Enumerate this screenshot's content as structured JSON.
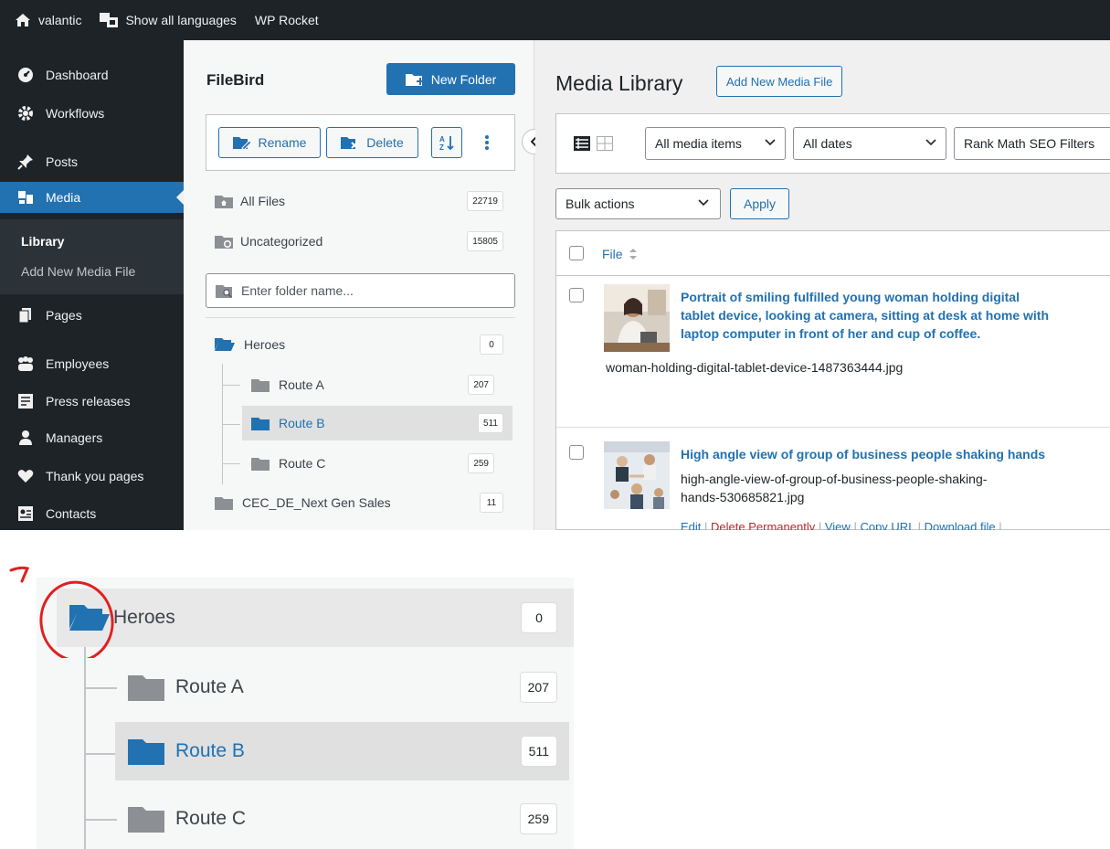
{
  "admin_bar": {
    "site_name": "valantic",
    "languages": "Show all languages",
    "wp_rocket": "WP Rocket"
  },
  "sidebar": {
    "items": [
      {
        "label": "Dashboard",
        "icon": "dashboard-icon"
      },
      {
        "label": "Workflows",
        "icon": "gear-icon"
      },
      {
        "label": "Posts",
        "icon": "pin-icon"
      },
      {
        "label": "Media",
        "icon": "media-icon"
      },
      {
        "label": "Pages",
        "icon": "pages-icon"
      },
      {
        "label": "Employees",
        "icon": "group-icon"
      },
      {
        "label": "Press releases",
        "icon": "document-icon"
      },
      {
        "label": "Managers",
        "icon": "person-icon"
      },
      {
        "label": "Thank you pages",
        "icon": "heart-icon"
      },
      {
        "label": "Contacts",
        "icon": "contact-card-icon"
      }
    ],
    "submenu": {
      "library": "Library",
      "add_new": "Add New Media File"
    }
  },
  "filebird": {
    "title": "FileBird",
    "new_folder": "New Folder",
    "rename": "Rename",
    "delete": "Delete",
    "all_files": {
      "label": "All Files",
      "count": "22719"
    },
    "uncategorized": {
      "label": "Uncategorized",
      "count": "15805"
    },
    "search_placeholder": "Enter folder name...",
    "folders": [
      {
        "label": "Heroes",
        "count": "0"
      },
      {
        "label": "Route A",
        "count": "207"
      },
      {
        "label": "Route B",
        "count": "511",
        "selected": true
      },
      {
        "label": "Route C",
        "count": "259"
      },
      {
        "label": "CEC_DE_Next Gen Sales",
        "count": "11"
      }
    ]
  },
  "media_library": {
    "title": "Media Library",
    "add_new": "Add New Media File",
    "filter_type": "All media items",
    "filter_date": "All dates",
    "filter_seo": "Rank Math SEO Filters",
    "bulk_actions": "Bulk actions",
    "apply": "Apply",
    "column_file": "File",
    "items": [
      {
        "title": [
          "Portrait of smiling fulfilled young woman holding digital",
          "tablet device, looking at camera, sitting at desk at home with",
          "laptop computer in front of her and cup of coffee."
        ],
        "filename": "woman-holding-digital-tablet-device-1487363444.jpg"
      },
      {
        "title": [
          "High angle view of group of business people shaking hands"
        ],
        "filename": [
          "high-angle-view-of-group-of-business-people-shaking-",
          "hands-530685821.jpg"
        ]
      }
    ],
    "row_actions": {
      "edit": "Edit",
      "delete": "Delete Permanently",
      "view": "View",
      "copy_url": "Copy URL",
      "download": "Download file",
      "sep": "|"
    }
  },
  "zoom_inset": {
    "folders": [
      {
        "label": "Heroes",
        "count": "0"
      },
      {
        "label": "Route A",
        "count": "207"
      },
      {
        "label": "Route B",
        "count": "511",
        "selected": true
      },
      {
        "label": "Route C",
        "count": "259"
      }
    ],
    "annotation_color": "#e02020"
  },
  "colors": {
    "wp_blue": "#2271b1",
    "admin_dark": "#1d2327",
    "folder_gray": "#8c8f94",
    "delete_red": "#b32d2e"
  }
}
